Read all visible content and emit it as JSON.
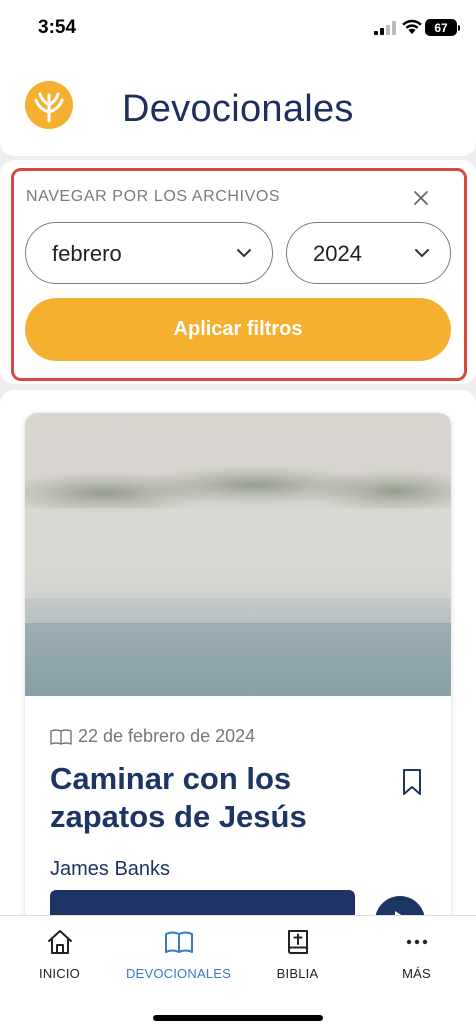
{
  "status_bar": {
    "time": "3:54",
    "battery": "67"
  },
  "header": {
    "title": "Devocionales",
    "logo_icon": "wheat-logo-icon"
  },
  "filter": {
    "heading": "NAVEGAR POR LOS ARCHIVOS",
    "month": "febrero",
    "year": "2024",
    "apply_label": "Aplicar filtros",
    "accent_color": "#f6b02f",
    "highlight_color": "#d64a3f"
  },
  "card": {
    "date": "22 de febrero de 2024",
    "title": "Caminar con los zapatos de Jesús",
    "author": "James Banks"
  },
  "tabs": [
    {
      "label": "INICIO",
      "icon": "home-icon"
    },
    {
      "label": "DEVOCIONALES",
      "icon": "book-icon",
      "active": true
    },
    {
      "label": "BIBLIA",
      "icon": "bible-icon"
    },
    {
      "label": "MÁS",
      "icon": "more-icon"
    }
  ]
}
